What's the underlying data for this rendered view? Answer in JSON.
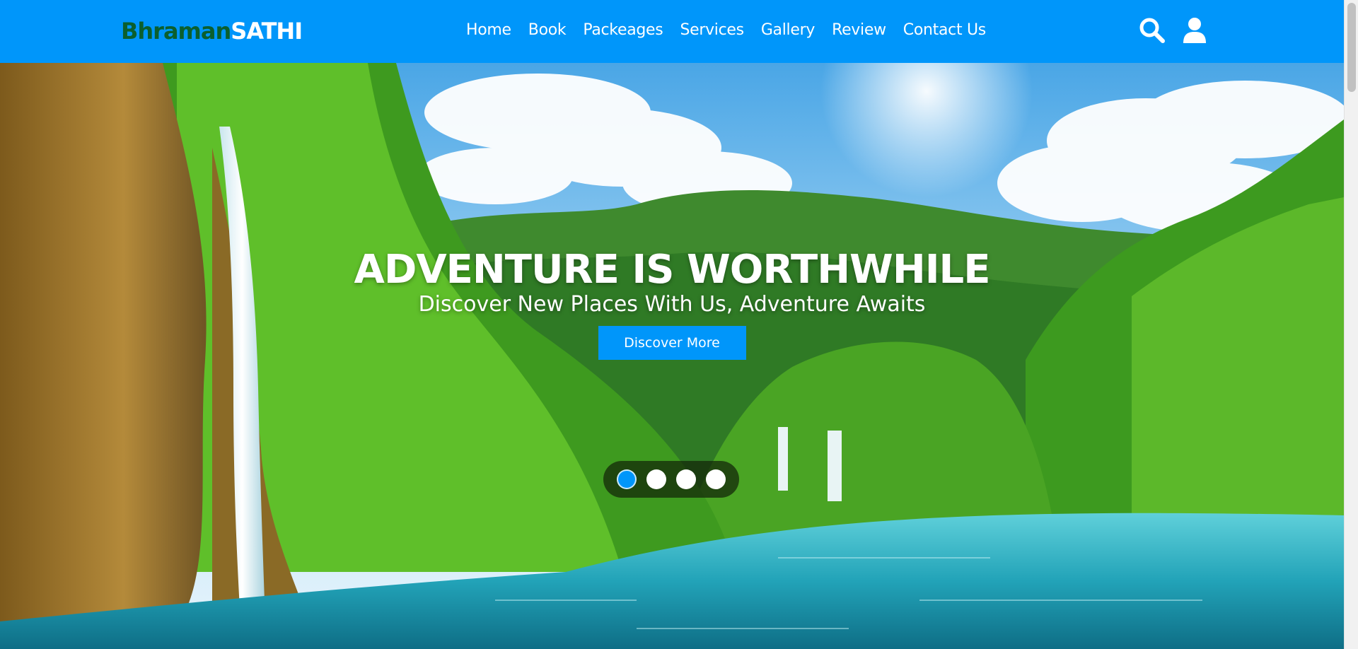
{
  "brand": {
    "part1": "Bhraman",
    "part2": "SATHI"
  },
  "nav": [
    "Home",
    "Book",
    "Packeages",
    "Services",
    "Gallery",
    "Review",
    "Contact Us"
  ],
  "header_icons": [
    "search-icon",
    "user-icon"
  ],
  "hero": {
    "title": "ADVENTURE IS WORTHWHILE",
    "subtitle": "Discover New Places With Us, Adventure Awaits",
    "button": "Discover More"
  },
  "slider": {
    "count": 4,
    "active": 0
  },
  "colors": {
    "accent": "#0096fa",
    "logo_dark": "#0b5f2e",
    "text_light": "#ffffff"
  }
}
